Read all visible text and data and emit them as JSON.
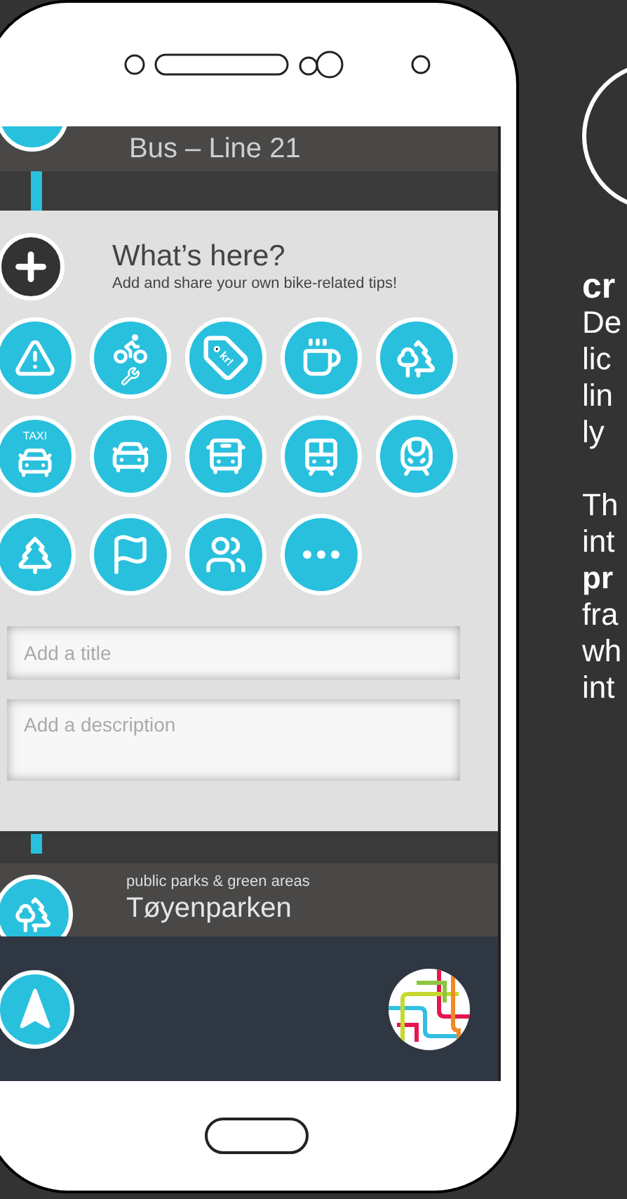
{
  "phone": {
    "route_header": {
      "title": "Bus – Line 21"
    },
    "tips_panel": {
      "title": "What’s here?",
      "subtitle": "Add and share your own bike-related tips!",
      "categories": [
        {
          "kind": "warning"
        },
        {
          "kind": "bike-repair"
        },
        {
          "kind": "price-tag",
          "label": "kr!"
        },
        {
          "kind": "cafe"
        },
        {
          "kind": "park"
        },
        {
          "kind": "taxi",
          "label": "TAXI"
        },
        {
          "kind": "car"
        },
        {
          "kind": "bus"
        },
        {
          "kind": "metro"
        },
        {
          "kind": "train"
        },
        {
          "kind": "forest"
        },
        {
          "kind": "flag"
        },
        {
          "kind": "family"
        },
        {
          "kind": "more"
        }
      ],
      "title_field": {
        "placeholder": "Add a title"
      },
      "description_field": {
        "placeholder": "Add a description"
      }
    },
    "place_item": {
      "category": "public parks & green areas",
      "name": "Tøyenparken"
    }
  },
  "side_text": {
    "heading": "cr",
    "paragraphs": [
      [
        {
          "text": "De",
          "bold": false
        },
        {
          "text": "lic",
          "bold": false
        },
        {
          "text": "lin",
          "bold": false
        },
        {
          "text": "ly",
          "bold": false
        }
      ],
      [
        {
          "text": "Th",
          "bold": false
        },
        {
          "text": "int",
          "bold": false
        },
        {
          "text": "pr",
          "bold": true
        },
        {
          "text": "fra",
          "bold": false
        },
        {
          "text": "wh",
          "bold": false
        },
        {
          "text": "int",
          "bold": false
        }
      ]
    ]
  }
}
